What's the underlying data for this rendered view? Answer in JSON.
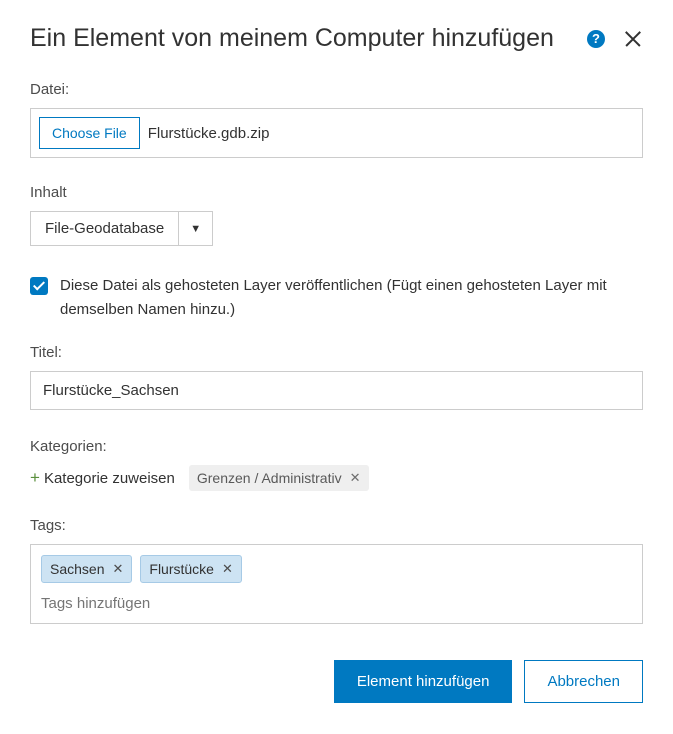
{
  "dialog": {
    "title": "Ein Element von meinem Computer hinzufügen"
  },
  "file": {
    "label": "Datei:",
    "choose_label": "Choose File",
    "filename": "Flurstücke.gdb.zip"
  },
  "content": {
    "label": "Inhalt",
    "selected": "File-Geodatabase"
  },
  "publish": {
    "checked": true,
    "label": "Diese Datei als gehosteten Layer veröffentlichen (Fügt einen gehosteten Layer mit demselben Namen hinzu.)"
  },
  "titlefield": {
    "label": "Titel:",
    "value": "Flurstücke_Sachsen"
  },
  "categories": {
    "label": "Kategorien:",
    "assign_label": "Kategorie zuweisen",
    "chips": [
      "Grenzen / Administrativ"
    ]
  },
  "tags": {
    "label": "Tags:",
    "chips": [
      "Sachsen",
      "Flurstücke"
    ],
    "placeholder": "Tags hinzufügen"
  },
  "footer": {
    "primary": "Element hinzufügen",
    "secondary": "Abbrechen"
  }
}
